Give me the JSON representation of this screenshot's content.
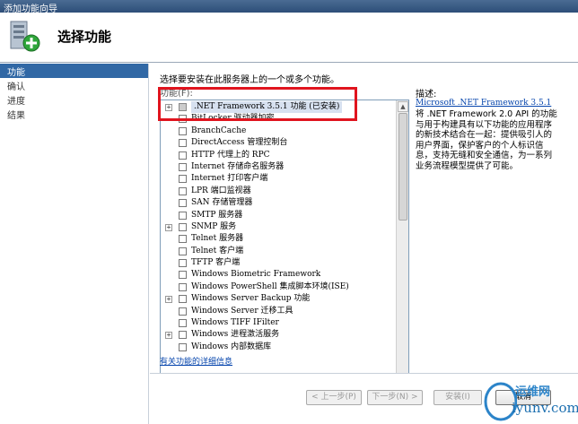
{
  "window": {
    "title": "添加功能向导"
  },
  "header": {
    "title": "选择功能"
  },
  "nav": {
    "items": [
      {
        "label": "功能",
        "active": true
      },
      {
        "label": "确认",
        "active": false
      },
      {
        "label": "进度",
        "active": false
      },
      {
        "label": "结果",
        "active": false
      }
    ]
  },
  "main": {
    "instruction": "选择要安装在此服务器上的一个或多个功能。",
    "features_label": "功能(F):",
    "features": [
      {
        "label": ".NET Framework 3.5.1 功能  (已安装)",
        "expandable": true,
        "checked": true,
        "selected": true
      },
      {
        "label": "BitLocker 驱动器加密",
        "expandable": false,
        "checked": false
      },
      {
        "label": "BranchCache",
        "expandable": false,
        "checked": false
      },
      {
        "label": "DirectAccess 管理控制台",
        "expandable": false,
        "checked": false
      },
      {
        "label": "HTTP 代理上的 RPC",
        "expandable": false,
        "checked": false
      },
      {
        "label": "Internet 存储命名服务器",
        "expandable": false,
        "checked": false
      },
      {
        "label": "Internet 打印客户端",
        "expandable": false,
        "checked": false
      },
      {
        "label": "LPR 端口监视器",
        "expandable": false,
        "checked": false
      },
      {
        "label": "SAN 存储管理器",
        "expandable": false,
        "checked": false
      },
      {
        "label": "SMTP 服务器",
        "expandable": false,
        "checked": false
      },
      {
        "label": "SNMP 服务",
        "expandable": true,
        "checked": false
      },
      {
        "label": "Telnet 服务器",
        "expandable": false,
        "checked": false
      },
      {
        "label": "Telnet 客户端",
        "expandable": false,
        "checked": false
      },
      {
        "label": "TFTP 客户端",
        "expandable": false,
        "checked": false
      },
      {
        "label": "Windows Biometric Framework",
        "expandable": false,
        "checked": false
      },
      {
        "label": "Windows PowerShell 集成脚本环境(ISE)",
        "expandable": false,
        "checked": false
      },
      {
        "label": "Windows Server Backup 功能",
        "expandable": true,
        "checked": false
      },
      {
        "label": "Windows Server 迁移工具",
        "expandable": false,
        "checked": false
      },
      {
        "label": "Windows TIFF IFilter",
        "expandable": false,
        "checked": false
      },
      {
        "label": "Windows 进程激活服务",
        "expandable": true,
        "checked": false
      },
      {
        "label": "Windows 内部数据库",
        "expandable": false,
        "checked": false
      }
    ],
    "more_info_link": "有关功能的详细信息"
  },
  "description": {
    "label": "描述:",
    "link": "Microsoft .NET Framework 3.5.1",
    "body": "将 .NET Framework 2.0 API 的功能与用于构建具有以下功能的应用程序的新技术结合在一起：提供吸引人的用户界面，保护客户的个人标识信息，支持无缝和安全通信，为一系列业务流程模型提供了可能。"
  },
  "footer": {
    "back_label": "< 上一步(P)",
    "next_label": "下一步(N) >",
    "install_label": "安装(I)",
    "cancel_label": "取消"
  },
  "watermark": {
    "line1": "运维网",
    "line2": "iyunv.com"
  },
  "colors": {
    "accent": "#3168a5",
    "highlight": "#e0141e",
    "link": "#0645ad"
  }
}
